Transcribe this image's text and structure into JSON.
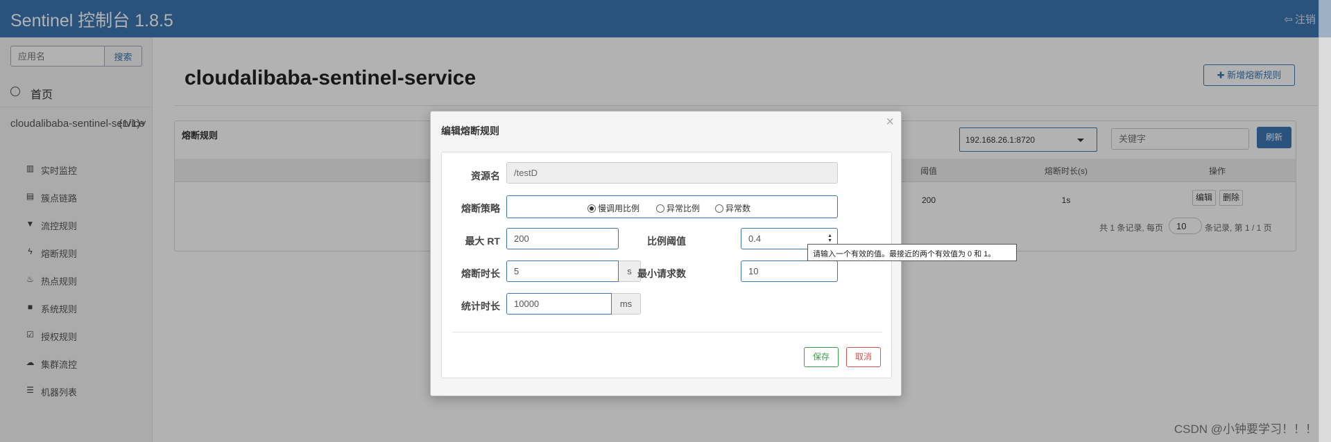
{
  "header": {
    "brand": "Sentinel 控制台 1.8.5",
    "logout_label": "注销",
    "colors": {
      "primary": "#3c76b3"
    }
  },
  "sidebar": {
    "search_placeholder": "应用名",
    "search_button": "搜索",
    "home_label": "首页",
    "app_name": "cloudalibaba-sentinel-service",
    "app_count": "(1/1)",
    "items": [
      {
        "icon": "bar-chart-icon",
        "label": "实时监控"
      },
      {
        "icon": "list-icon",
        "label": "簇点链路"
      },
      {
        "icon": "filter-icon",
        "label": "流控规则"
      },
      {
        "icon": "flash-icon",
        "label": "熔断规则"
      },
      {
        "icon": "fire-icon",
        "label": "热点规则"
      },
      {
        "icon": "lock-icon",
        "label": "系统规则"
      },
      {
        "icon": "check-icon",
        "label": "授权规则"
      },
      {
        "icon": "cloud-icon",
        "label": "集群流控"
      },
      {
        "icon": "th-list-icon",
        "label": "机器列表"
      }
    ]
  },
  "main": {
    "title": "cloudalibaba-sentinel-service",
    "add_button": "新增熔断规则",
    "panel_title": "熔断规则",
    "machine_select": "192.168.26.1:8720",
    "keyword_placeholder": "关键字",
    "refresh_button": "刷新",
    "columns": {
      "threshold": "阈值",
      "duration": "熔断时长(s)",
      "ops": "操作"
    },
    "row": {
      "threshold": "200",
      "duration": "1s",
      "edit": "编辑",
      "delete": "删除"
    },
    "pager": {
      "prefix": "共 1 条记录, 每页",
      "page_size": "10",
      "suffix": "条记录, 第 1 / 1 页"
    }
  },
  "modal": {
    "title": "编辑熔断规则",
    "close": "×",
    "resource_label": "资源名",
    "resource_value": "/testD",
    "strategy_label": "熔断策略",
    "strategies": [
      "慢调用比例",
      "异常比例",
      "异常数"
    ],
    "selected_strategy": "慢调用比例",
    "max_rt_label": "最大 RT",
    "max_rt_value": "200",
    "ratio_label": "比例阈值",
    "ratio_value": "0.4",
    "duration_label": "熔断时长",
    "duration_value": "5",
    "duration_unit": "s",
    "min_req_label": "最小请求数",
    "min_req_value": "10",
    "stat_label": "统计时长",
    "stat_value": "10000",
    "stat_unit": "ms",
    "save_button": "保存",
    "cancel_button": "取消",
    "validation_tooltip": "请输入一个有效的值。最接近的两个有效值为 0 和 1。"
  },
  "watermark": "CSDN @小钟要学习！！！"
}
